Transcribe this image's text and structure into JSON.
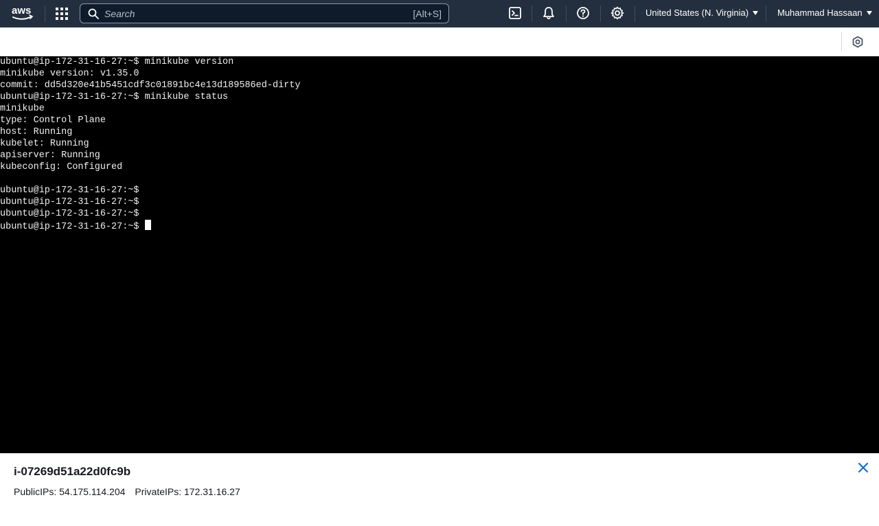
{
  "nav": {
    "logo_text": "aws",
    "search_placeholder": "Search",
    "search_shortcut": "[Alt+S]",
    "region": "United States (N. Virginia)",
    "user": "Muhammad Hassaan"
  },
  "terminal": {
    "lines": [
      "ubuntu@ip-172-31-16-27:~$ minikube version",
      "minikube version: v1.35.0",
      "commit: dd5d320e41b5451cdf3c01891bc4e13d189586ed-dirty",
      "ubuntu@ip-172-31-16-27:~$ minikube status",
      "minikube",
      "type: Control Plane",
      "host: Running",
      "kubelet: Running",
      "apiserver: Running",
      "kubeconfig: Configured",
      "",
      "ubuntu@ip-172-31-16-27:~$",
      "ubuntu@ip-172-31-16-27:~$",
      "ubuntu@ip-172-31-16-27:~$"
    ],
    "prompt": "ubuntu@ip-172-31-16-27:~$ "
  },
  "instance": {
    "id": "i-07269d51a22d0fc9b",
    "public_ips": "PublicIPs: 54.175.114.204",
    "private_ips": "PrivateIPs: 172.31.16.27"
  },
  "colors": {
    "nav_bg": "#232f3e",
    "terminal_bg": "#000000",
    "close_icon": "#0972d3"
  }
}
